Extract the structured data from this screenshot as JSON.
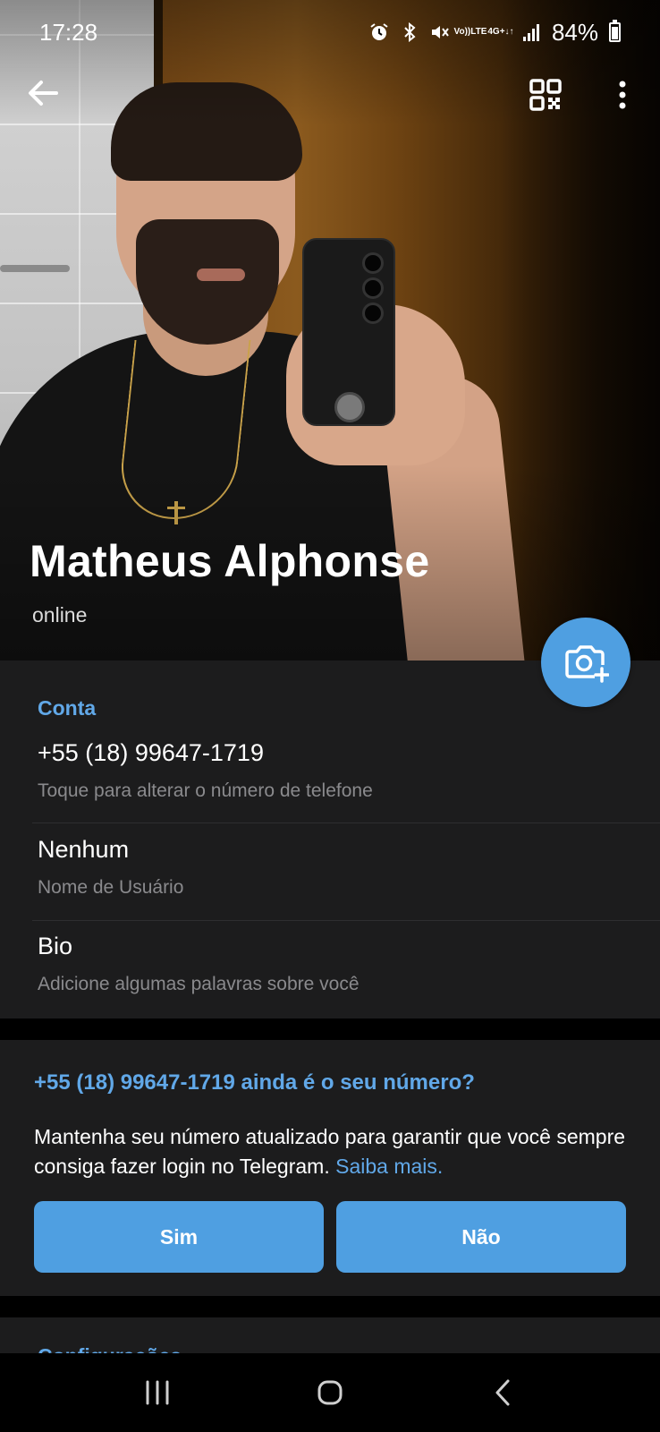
{
  "status_bar": {
    "time": "17:28",
    "battery": "84%",
    "volte_top": "Vo))",
    "volte_bottom": "LTE",
    "network_top": "4G+",
    "network_bottom": "↓↑",
    "icons": [
      "alarm-icon",
      "bluetooth-icon",
      "mute-icon",
      "volte-icon",
      "network-4g-icon",
      "signal-icon",
      "battery-icon"
    ]
  },
  "toolbar": {
    "back_icon": "arrow-left-icon",
    "qr_icon": "qr-code-icon",
    "menu_icon": "more-vertical-icon"
  },
  "profile": {
    "name": "Matheus Alphonse",
    "status": "online"
  },
  "account": {
    "section_title": "Conta",
    "phone": "+55 (18) 99647-1719",
    "phone_hint": "Toque para alterar o número de telefone",
    "username": "Nenhum",
    "username_hint": "Nome de Usuário",
    "bio": "Bio",
    "bio_hint": "Adicione algumas palavras sobre você"
  },
  "verify": {
    "title": "+55 (18) 99647-1719 ainda é o seu número?",
    "text": "Mantenha seu número atualizado para garantir que você sempre consiga fazer login no Telegram.",
    "link": "Saiba mais.",
    "yes_label": "Sim",
    "no_label": "Não"
  },
  "settings": {
    "section_title": "Configurações"
  },
  "colors": {
    "accent": "#61a8e8",
    "button": "#4f9fe1",
    "section_bg": "#1c1c1d",
    "hint": "#8a8a8d"
  }
}
